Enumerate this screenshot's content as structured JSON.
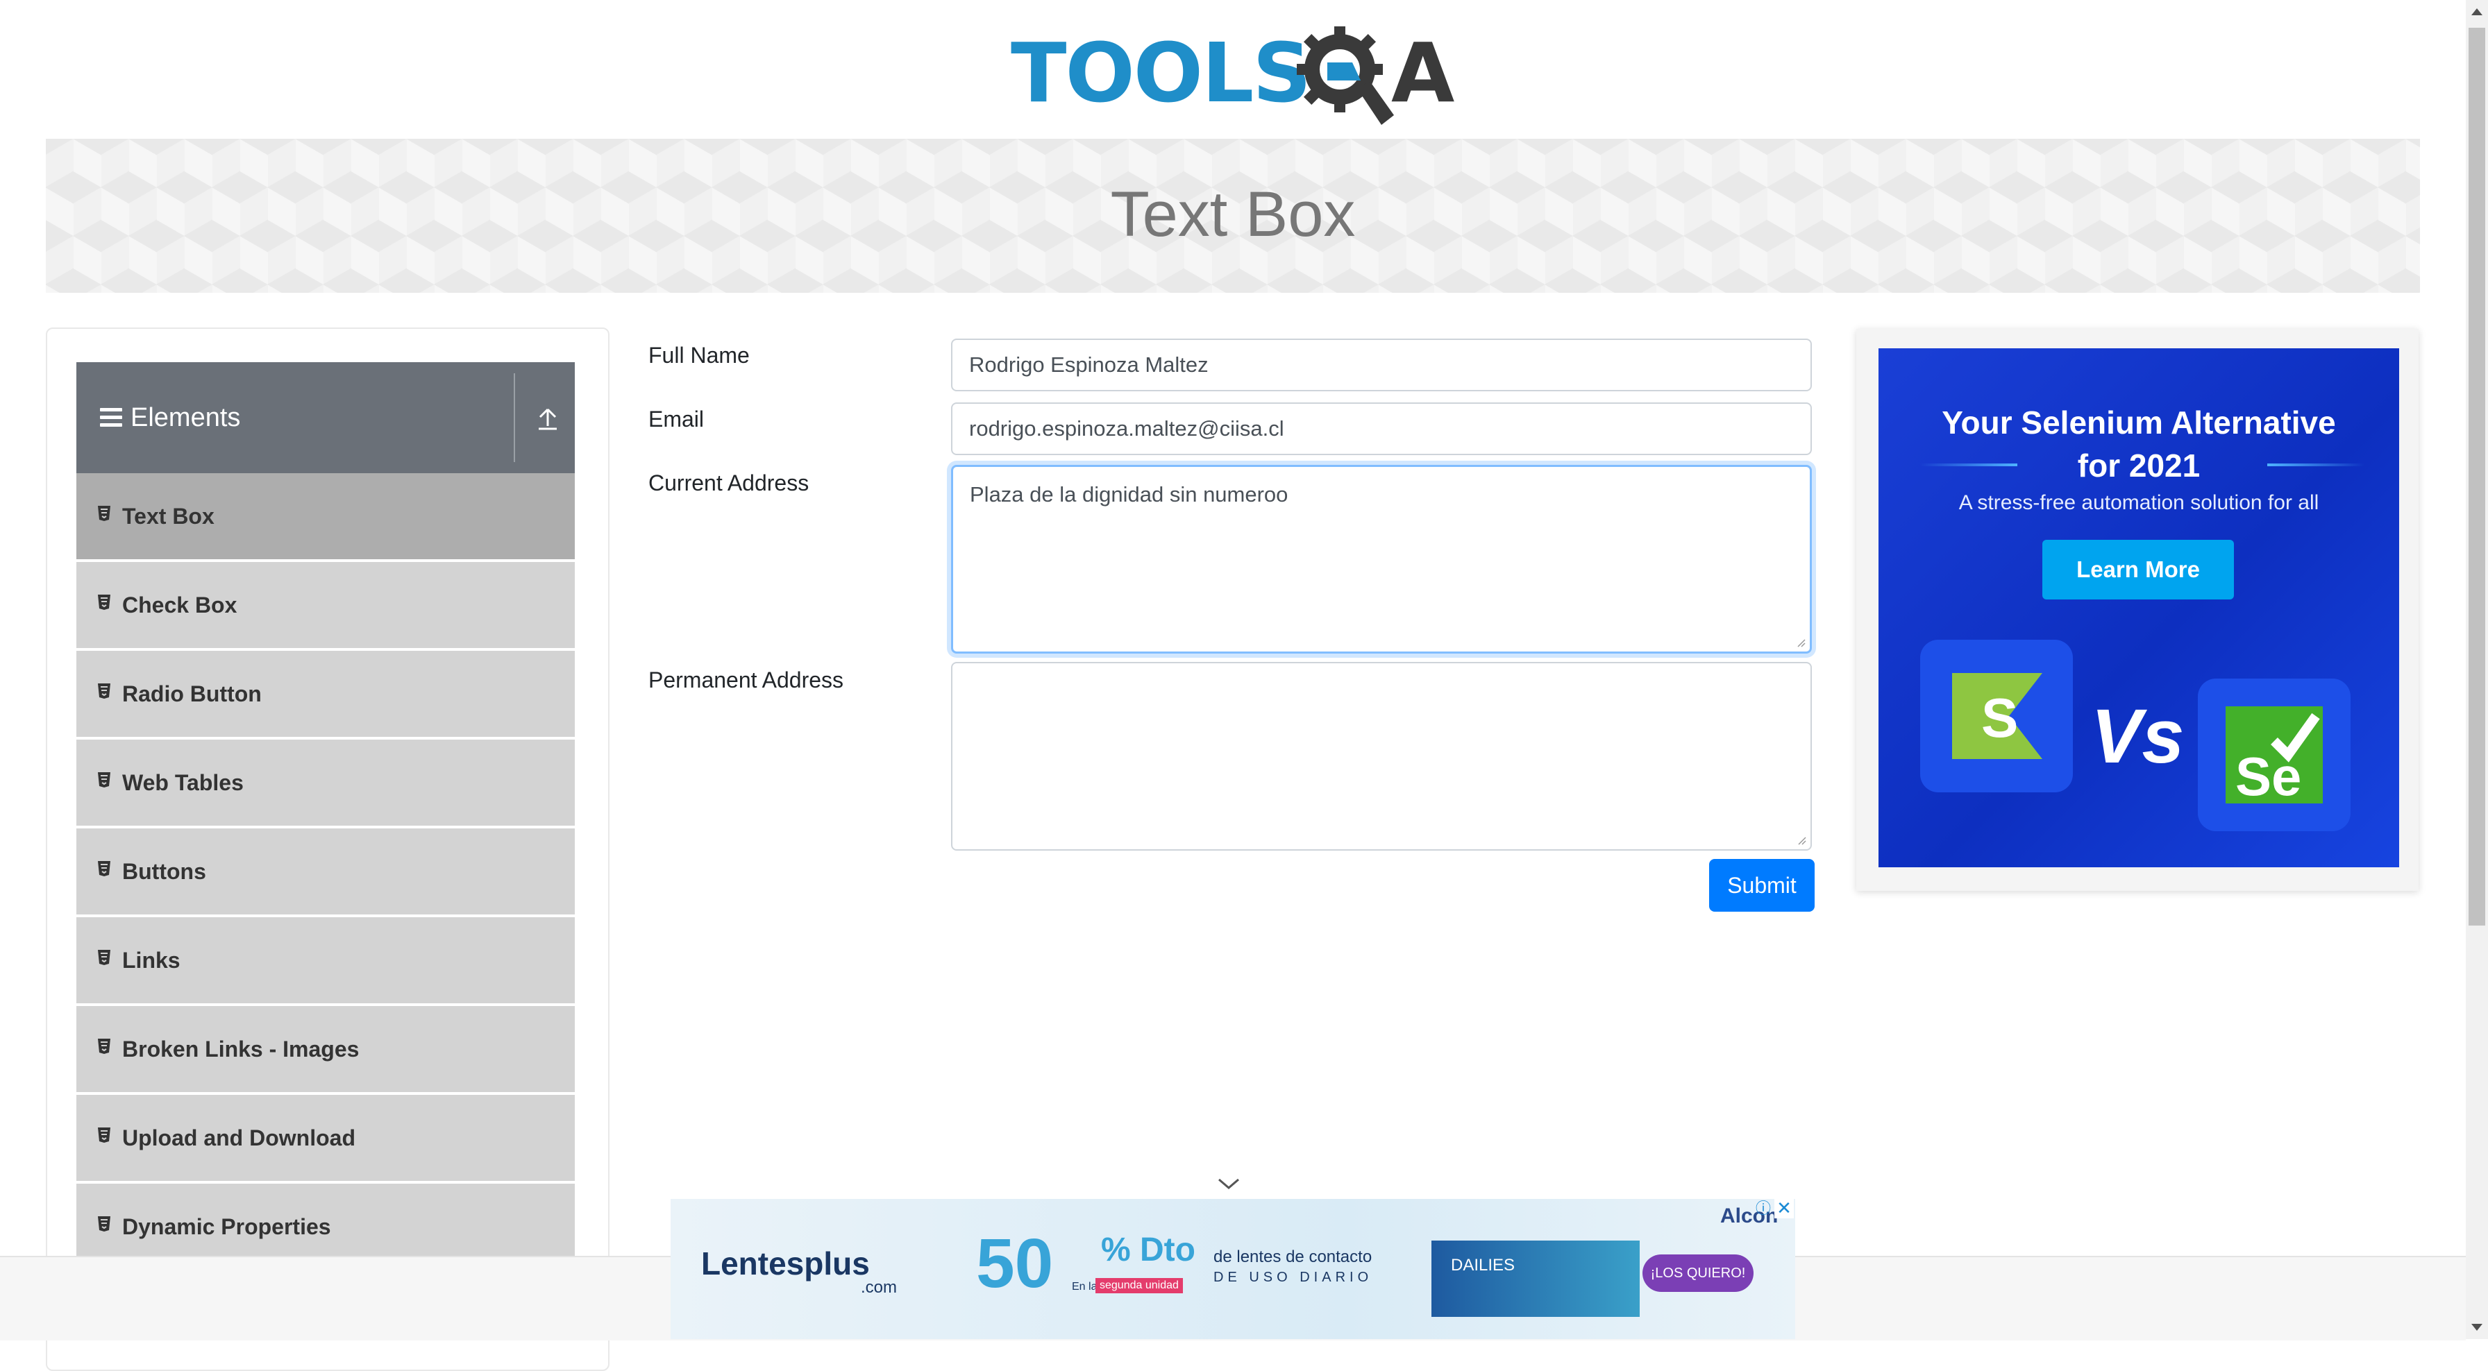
{
  "header": {
    "logo_text": "TOOLS",
    "logo_q": "Q",
    "logo_a": "A"
  },
  "banner": {
    "title": "Text Box"
  },
  "sidebar": {
    "group": "Elements",
    "items": [
      {
        "label": "Text Box",
        "active": true
      },
      {
        "label": "Check Box"
      },
      {
        "label": "Radio Button"
      },
      {
        "label": "Web Tables"
      },
      {
        "label": "Buttons"
      },
      {
        "label": "Links"
      },
      {
        "label": "Broken Links - Images"
      },
      {
        "label": "Upload and Download"
      },
      {
        "label": "Dynamic Properties"
      }
    ]
  },
  "form": {
    "full_name_label": "Full Name",
    "full_name_value": "Rodrigo Espinoza Maltez",
    "email_label": "Email",
    "email_value": "rodrigo.espinoza.maltez@ciisa.cl",
    "current_address_label": "Current Address",
    "current_address_value": "Plaza de la dignidad sin numeroo",
    "permanent_address_label": "Permanent Address",
    "permanent_address_value": "",
    "submit_label": "Submit"
  },
  "ad_right": {
    "headline": "Your Selenium Alternative for 2021",
    "subline": "A stress-free automation solution for all",
    "cta": "Learn More",
    "vs": "Vs",
    "logo_left": "S",
    "logo_right": "Se"
  },
  "ad_bottom": {
    "brand": "Lentesplus",
    "brand_suffix": ".com",
    "discount": "50",
    "pct_dto": "% Dto",
    "line1": "de lentes de contacto",
    "line2": "DE USO DIARIO",
    "en_la": "En la",
    "segunda": "segunda unidad",
    "product": "DAILIES",
    "cta": "¡LOS QUIERO!",
    "sponsor": "Alcon"
  },
  "colors": {
    "primary": "#007bff",
    "logo_blue": "#1f8ec9",
    "sidebar_active": "#adadad",
    "sidebar_item": "#d3d3d3",
    "sidebar_header": "#6a7078"
  }
}
